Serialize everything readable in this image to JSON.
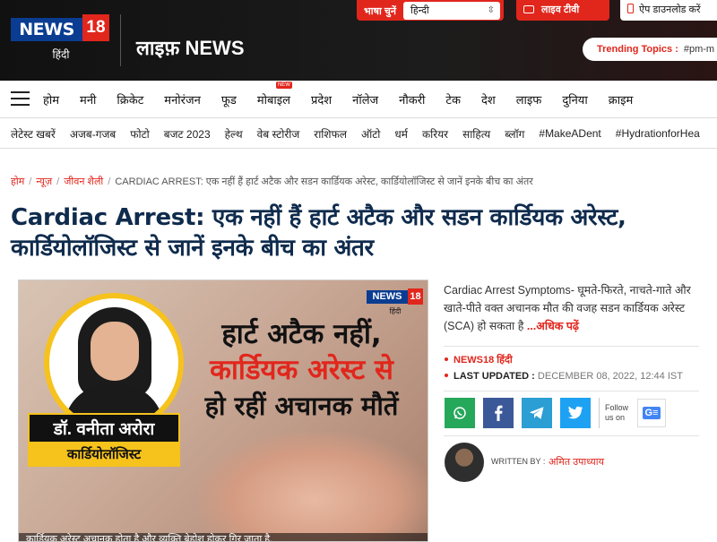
{
  "header": {
    "logo_text": "NEWS",
    "logo_number": "18",
    "logo_sub": "हिंदी",
    "section_title": "लाइफ़ NEWS",
    "language_label": "भाषा चुनें",
    "language_value": "हिन्दी",
    "live_tv_label": "लाइव टीवी",
    "app_download_label": "ऐप डाउनलोड करें",
    "trending_label": "Trending Topics :",
    "trending_tag": "#pm-m"
  },
  "nav_primary": {
    "items": [
      "होम",
      "मनी",
      "क्रिकेट",
      "मनोरंजन",
      "फूड",
      "मोबाइल",
      "प्रदेश",
      "नॉलेज",
      "नौकरी",
      "टेक",
      "देश",
      "लाइफ",
      "दुनिया",
      "क्राइम"
    ],
    "new_badge": "NEW"
  },
  "nav_secondary": {
    "items": [
      "लेटेस्ट खबरें",
      "अजब-गजब",
      "फोटो",
      "बजट 2023",
      "हेल्थ",
      "वेब स्टोरीज",
      "राशिफल",
      "ऑटो",
      "धर्म",
      "करियर",
      "साहित्य",
      "ब्लॉग",
      "#MakeADent",
      "#HydrationforHea"
    ]
  },
  "breadcrumb": {
    "home": "होम",
    "news": "न्यूज़",
    "lifestyle": "जीवन शैली",
    "current": "CARDIAC ARREST: एक नहीं हैं हार्ट अटैक और सडन कार्डियक अरेस्ट, कार्डियोलॉजिस्ट से जानें इनके बीच का अंतर"
  },
  "article": {
    "headline": "Cardiac Arrest: एक नहीं हैं हार्ट अटैक और सडन कार्डियक अरेस्ट, कार्डियोलॉजिस्ट से जानें इनके बीच का अंतर",
    "summary": "Cardiac Arrest Symptoms- घूमते-फिरते, नाचते-गाते और खाते-पीते वक्त अचानक मौत की वजह सडन कार्डियक अरेस्ट (SCA) हो सकता है ",
    "read_more": "...अधिक पढ़ें",
    "source": "NEWS18 हिंदी",
    "last_updated_label": "LAST UPDATED :",
    "last_updated_value": "DECEMBER 08, 2022, 12:44 IST",
    "follow_label": "Follow us on",
    "google_news_badge": "G≡",
    "author_label": "WRITTEN BY :",
    "author_name": "अमित उपाध्याय"
  },
  "hero_image": {
    "logo_text": "NEWS",
    "logo_number": "18",
    "logo_sub": "हिंदी",
    "line1": "हार्ट अटैक नहीं,",
    "line2": "कार्डियक अरेस्ट से",
    "line3": "हो रहीं अचानक मौतें",
    "doctor_name": "डॉ. वनीता अरोरा",
    "doctor_title": "कार्डियोलॉजिस्ट",
    "caption": "कार्डियक अरेस्ट अचानक होता है और व्यक्ति बेहोश होकर गिर जाता है."
  },
  "colors": {
    "brand_red": "#e1261c",
    "brand_blue": "#0a3d91",
    "headline_navy": "#0f2b4d",
    "accent_yellow": "#f6c21c"
  }
}
